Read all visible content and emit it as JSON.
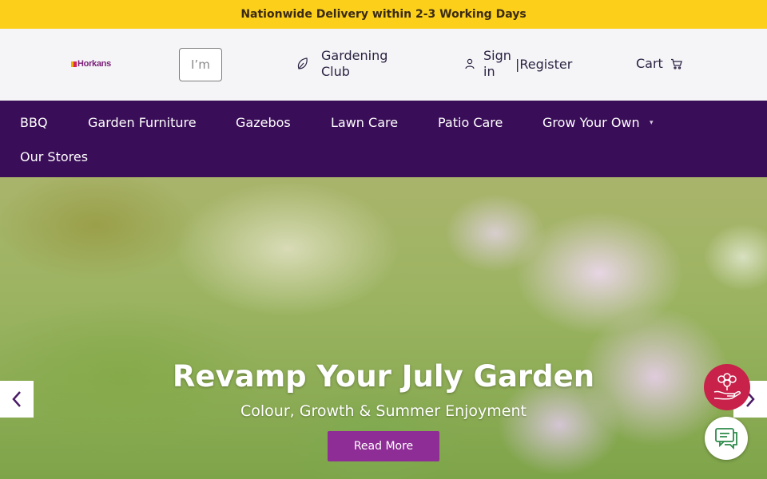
{
  "promo": {
    "text": "Nationwide Delivery within 2-3 Working Days"
  },
  "header": {
    "logo_text": "Horkans",
    "search_placeholder": "I’m",
    "club_label": "Gardening Club",
    "signin_label": "Sign in",
    "separator": "|",
    "register_label": "Register",
    "cart_label": "Cart"
  },
  "nav": {
    "items": [
      {
        "label": "BBQ"
      },
      {
        "label": "Garden Furniture"
      },
      {
        "label": "Gazebos"
      },
      {
        "label": "Lawn Care"
      },
      {
        "label": "Patio Care"
      },
      {
        "label": "Grow Your Own",
        "has_dropdown": true
      },
      {
        "label": "Our Stores"
      }
    ]
  },
  "hero": {
    "title": "Revamp Your July Garden",
    "subtitle": "Colour, Growth & Summer Enjoyment",
    "cta_label": "Read More"
  },
  "icons": {
    "leaf": "leaf-icon",
    "user": "user-icon",
    "cart": "cart-icon",
    "prev": "chevron-left-icon",
    "next": "chevron-right-icon",
    "rewards": "rewards-icon",
    "chat": "chat-icon"
  },
  "colors": {
    "promo_bg": "#fccf1a",
    "header_bg": "#f5f4f7",
    "nav_bg": "#390d57",
    "cta_bg": "#8e2d96",
    "rewards_bg": "#c8224a",
    "arrow": "#4a1b66"
  }
}
